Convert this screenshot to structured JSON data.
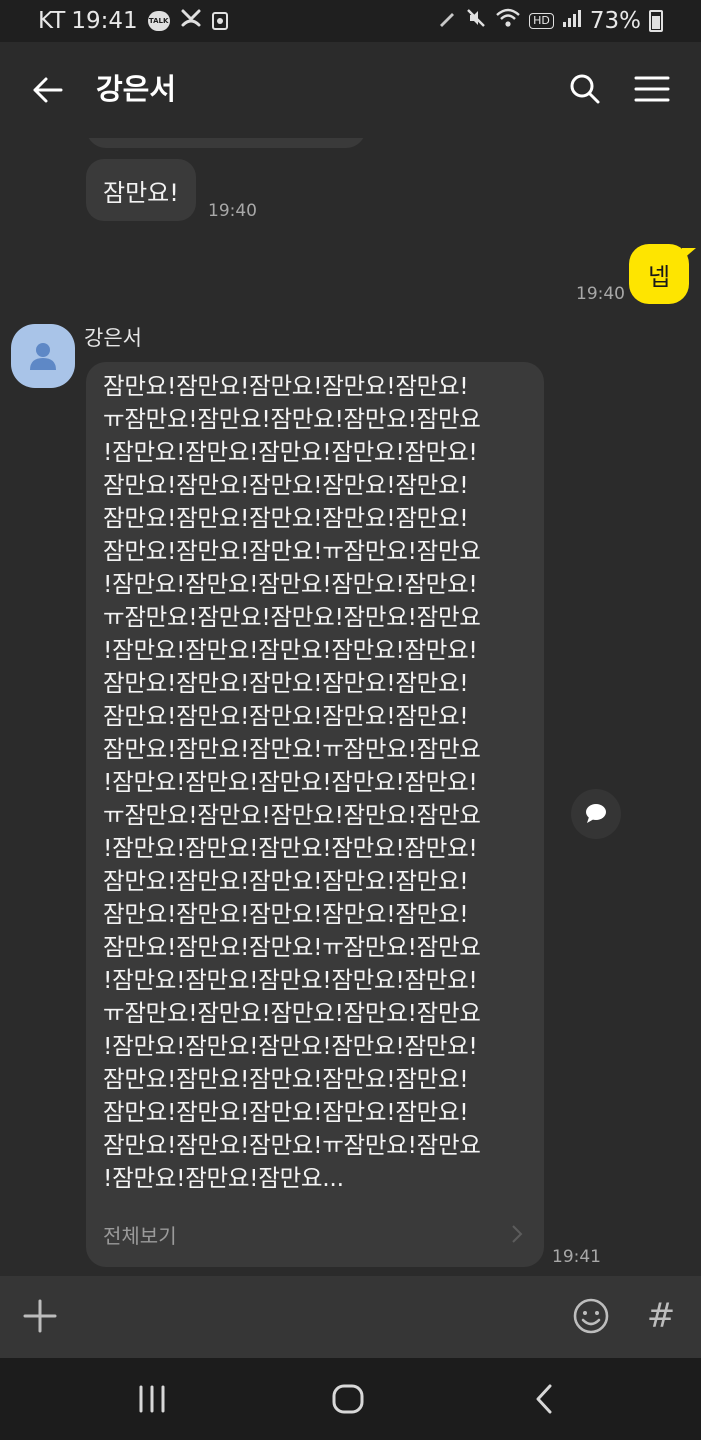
{
  "status_bar": {
    "carrier": "KT",
    "time": "19:41",
    "talk_icon_text": "TALK",
    "network_badge": "HD",
    "battery_percent": "73%",
    "icons": [
      "talk-notification-icon",
      "missed-call-icon",
      "screen-record-icon",
      "pen-icon",
      "mute-icon",
      "wifi-icon",
      "signal-icon",
      "battery-icon"
    ]
  },
  "header": {
    "title": "강은서",
    "icons": [
      "back-arrow-icon",
      "search-icon",
      "menu-icon"
    ]
  },
  "messages": [
    {
      "from": "other",
      "text": "잠만요!",
      "time": "19:40"
    },
    {
      "from": "me",
      "text": "넵",
      "time": "19:40"
    },
    {
      "from": "other",
      "sender": "강은서",
      "lines": [
        "잠만요!잠만요!잠만요!잠만요!잠만요!",
        "ㅠ잠만요!잠만요!잠만요!잠만요!잠만요",
        "!잠만요!잠만요!잠만요!잠만요!잠만요!",
        "잠만요!잠만요!잠만요!잠만요!잠만요!",
        "잠만요!잠만요!잠만요!잠만요!잠만요!",
        "잠만요!잠만요!잠만요!ㅠ잠만요!잠만요",
        "!잠만요!잠만요!잠만요!잠만요!잠만요!",
        "ㅠ잠만요!잠만요!잠만요!잠만요!잠만요",
        "!잠만요!잠만요!잠만요!잠만요!잠만요!",
        "잠만요!잠만요!잠만요!잠만요!잠만요!",
        "잠만요!잠만요!잠만요!잠만요!잠만요!",
        "잠만요!잠만요!잠만요!ㅠ잠만요!잠만요",
        "!잠만요!잠만요!잠만요!잠만요!잠만요!",
        "ㅠ잠만요!잠만요!잠만요!잠만요!잠만요",
        "!잠만요!잠만요!잠만요!잠만요!잠만요!",
        "잠만요!잠만요!잠만요!잠만요!잠만요!",
        "잠만요!잠만요!잠만요!잠만요!잠만요!",
        "잠만요!잠만요!잠만요!ㅠ잠만요!잠만요",
        "!잠만요!잠만요!잠만요!잠만요!잠만요!",
        "ㅠ잠만요!잠만요!잠만요!잠만요!잠만요",
        "!잠만요!잠만요!잠만요!잠만요!잠만요!",
        "잠만요!잠만요!잠만요!잠만요!잠만요!",
        "잠만요!잠만요!잠만요!잠만요!잠만요!",
        "잠만요!잠만요!잠만요!ㅠ잠만요!잠만요",
        "!잠만요!잠만요!잠만요..."
      ],
      "see_all_label": "전체보기",
      "time": "19:41"
    }
  ],
  "input_bar": {
    "hash_label": "#",
    "icons": [
      "plus-icon",
      "emoji-icon",
      "hash-icon"
    ]
  },
  "nav_bar": {
    "icons": [
      "recent-apps-icon",
      "home-icon",
      "back-icon"
    ]
  },
  "colors": {
    "background": "#2b2b2b",
    "bubble_other": "#3a3a3a",
    "bubble_mine": "#fee500",
    "timestamp": "#a8a8a8"
  }
}
